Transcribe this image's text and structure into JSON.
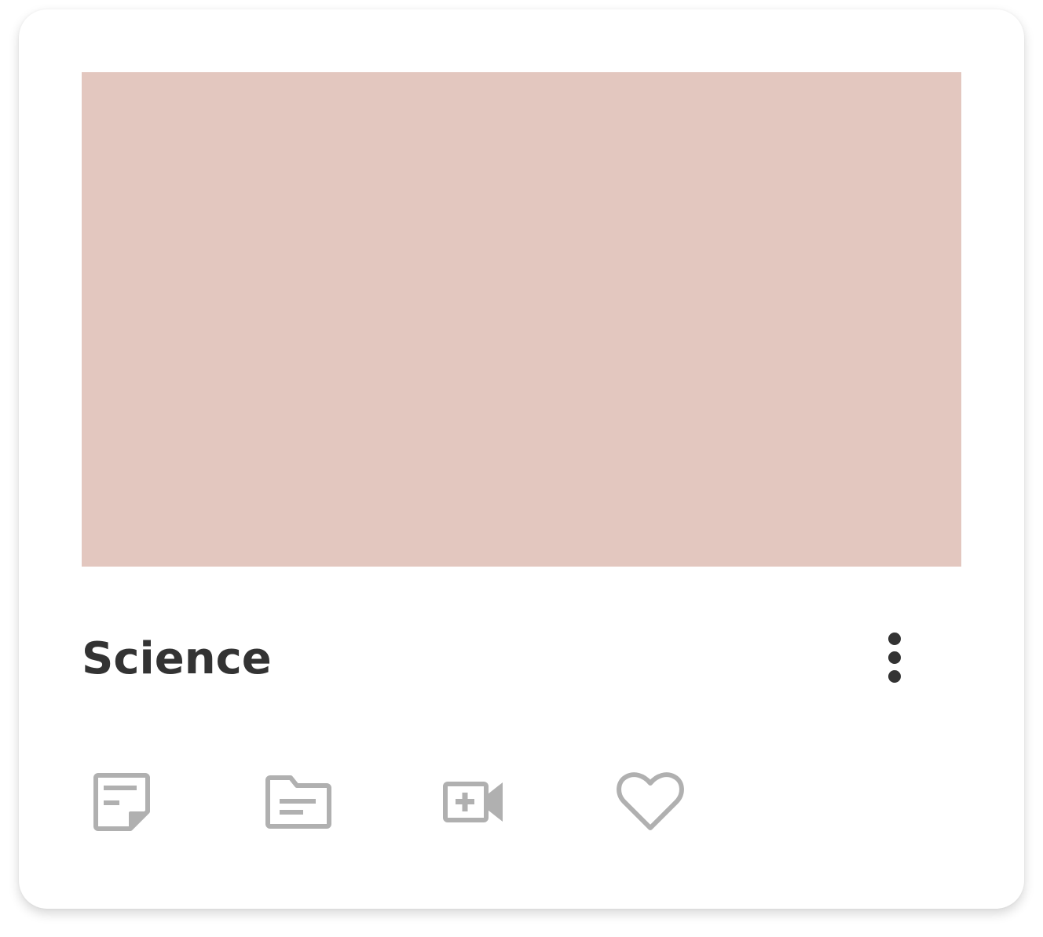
{
  "card": {
    "title": "Science",
    "cover_color": "#e3c7bf",
    "title_color": "#333333",
    "icon_color": "#b0b0b0"
  },
  "actions": [
    {
      "icon": "notes-icon"
    },
    {
      "icon": "folder-icon"
    },
    {
      "icon": "video-add-icon"
    },
    {
      "icon": "heart-icon"
    }
  ],
  "menu": {
    "icon": "more-vertical-icon"
  }
}
